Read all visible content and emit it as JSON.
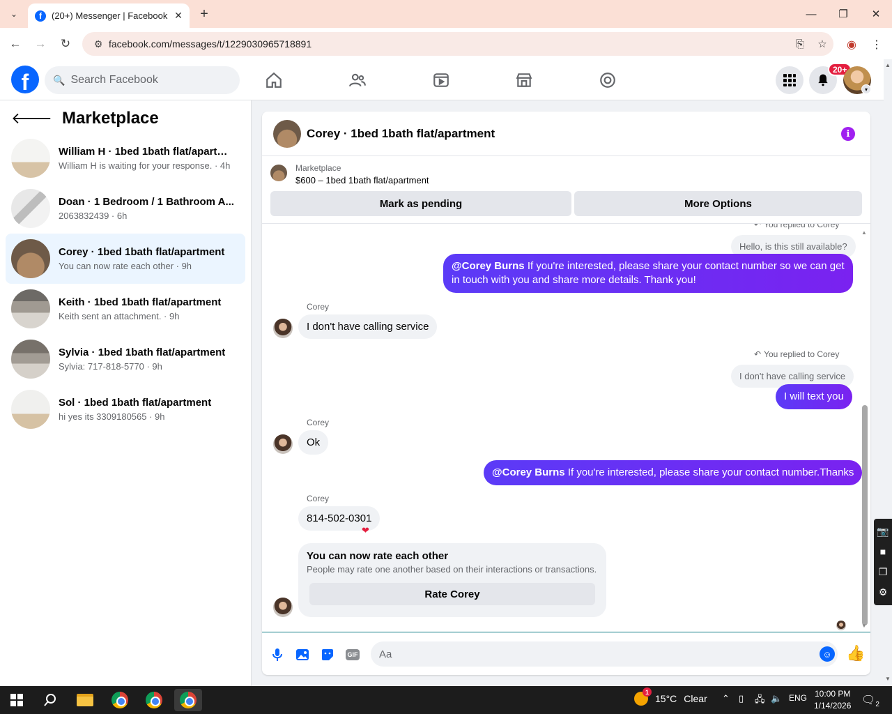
{
  "browser": {
    "tab_title": "(20+) Messenger | Facebook",
    "url": "facebook.com/messages/t/1229030965718891"
  },
  "header": {
    "search_placeholder": "Search Facebook",
    "notification_badge": "20+"
  },
  "sidebar": {
    "title": "Marketplace",
    "conversations": [
      {
        "name": "William H · 1bed 1bath flat/apartm...",
        "subtitle": "William H is waiting for your response. · 4h",
        "active": false
      },
      {
        "name": "Doan · 1 Bedroom / 1 Bathroom A...",
        "subtitle": "2063832439 · 6h",
        "active": false
      },
      {
        "name": "Corey · 1bed 1bath flat/apartment",
        "subtitle": "You can now rate each other · 9h",
        "active": true
      },
      {
        "name": "Keith · 1bed 1bath flat/apartment",
        "subtitle": "Keith sent an attachment. · 9h",
        "active": false
      },
      {
        "name": "Sylvia · 1bed 1bath flat/apartment",
        "subtitle": "Sylvia: 717-818-5770 · 9h",
        "active": false
      },
      {
        "name": "Sol · 1bed 1bath flat/apartment",
        "subtitle": "hi yes its 3309180565 · 9h",
        "active": false
      }
    ]
  },
  "chat": {
    "title": "Corey · 1bed 1bath flat/apartment",
    "marketplace_label": "Marketplace",
    "listing": "$600 – 1bed 1bath flat/apartment",
    "mark_pending": "Mark as pending",
    "more_options": "More Options",
    "messages": {
      "replied_1": "You replied to Corey",
      "quote_1": "Hello, is this still available?",
      "out_1_mention": "@Corey Burns",
      "out_1_text": " If you're interested, please share your contact number so we can get in touch with you and share more details. Thank you!",
      "sender_1": "Corey",
      "in_1": "I don't have calling service",
      "replied_2": "You replied to Corey",
      "quote_2": "I don't have calling service",
      "out_2": "I will text you",
      "sender_2": "Corey",
      "in_2": "Ok",
      "out_3_mention": "@Corey Burns",
      "out_3_text": " If you're interested, please share your contact number.Thanks",
      "sender_3": "Corey",
      "in_3": "814-502-0301",
      "rate_title": "You can now rate each other",
      "rate_desc": "People may rate one another based on their interactions or transactions.",
      "rate_button": "Rate Corey"
    },
    "composer_placeholder": "Aa"
  },
  "taskbar": {
    "temperature": "15°C",
    "weather": "Clear",
    "weather_badge": "1",
    "language": "ENG",
    "time": "10:00 PM",
    "date": "1/14/2026",
    "notification_count": "2"
  },
  "colors": {
    "fb_blue": "#0866ff",
    "outgoing_bubble": "#6b2cf5",
    "active_conversation": "#ebf5ff"
  }
}
